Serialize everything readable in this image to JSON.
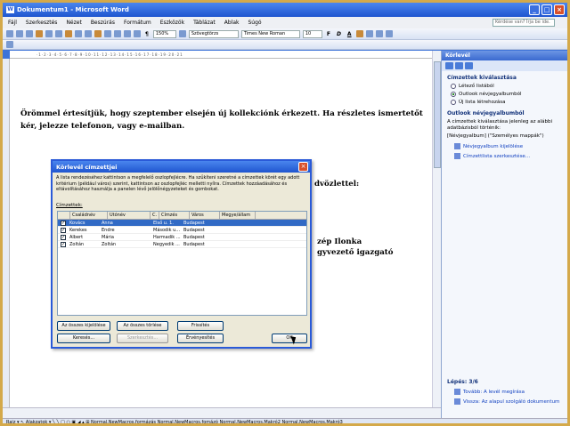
{
  "window": {
    "title": "Dokumentum1 - Microsoft Word",
    "app_icon": "W"
  },
  "menu": {
    "items": [
      "Fájl",
      "Szerkesztés",
      "Nézet",
      "Beszúrás",
      "Formátum",
      "Eszközök",
      "Táblázat",
      "Ablak",
      "Súgó"
    ],
    "help_placeholder": "Kérdése van? Írja be ide."
  },
  "toolbar": {
    "zoom": "150%",
    "style": "Szövegtörzs",
    "font": "Times New Roman",
    "size": "10",
    "bold": "F",
    "italic": "D",
    "underline": "A"
  },
  "document": {
    "paragraph": "Örömmel értesítjük, hogy szeptember elsején új kollekciónk érkezett. Ha részletes ismertetőt kér, jelezze telefonon, vagy e-mailban.",
    "greeting_fragment": "dvözlettel:",
    "signature_name_fragment": "zép Ilonka",
    "signature_title_fragment": "gyvezető igazgató"
  },
  "dialog": {
    "title": "Körlevél címzettjei",
    "description": "A lista rendezéséhez kattintson a megfelelő oszlopfejlécre. Ha szűkíteni szeretné a címzettek körét egy adott kritérium (például város) szerint, kattintson az oszlopfejléc melletti nyílra. Címzettek hozzáadásához és eltávolításához használja a panelen lévő jelölőnégyzeteket és gombokat.",
    "list_label": "Címzettek:",
    "columns": [
      "Családnév",
      "Utónév",
      "C.",
      "Címzés",
      "Város",
      "Megye/állam"
    ],
    "rows": [
      {
        "checked": true,
        "last": "Kovács",
        "first": "Anna",
        "address": "Első u. 1.",
        "city": "Budapest",
        "selected": true
      },
      {
        "checked": true,
        "last": "Kerekes",
        "first": "Endre",
        "address": "Második u...",
        "city": "Budapest",
        "selected": false
      },
      {
        "checked": true,
        "last": "Albert",
        "first": "Mária",
        "address": "Harmadik ...",
        "city": "Budapest",
        "selected": false
      },
      {
        "checked": true,
        "last": "Zoltán",
        "first": "Zoltán",
        "address": "Negyedik ...",
        "city": "Budapest",
        "selected": false
      }
    ],
    "buttons": {
      "select_all": "Az összes kijelölése",
      "clear_all": "Az összes törlése",
      "refresh": "Frissítés",
      "find": "Keresés...",
      "edit": "Szerkesztés...",
      "validate": "Érvényesítés",
      "ok": "OK"
    }
  },
  "taskpane": {
    "title": "Körlevél",
    "section1_title": "Címzettek kiválasztása",
    "options": [
      "Létező listából",
      "Outlook névjegyalbumból",
      "Új lista létrehozása"
    ],
    "selected_option_index": 1,
    "section2_title": "Outlook névjegyalbumból",
    "section2_text": "A címzettek kiválasztása jelenleg az alábbi adatbázisból történik:",
    "source": "[Névjegyalbum] (\"Személyes mappák\")",
    "link1": "Névjegyalbum kijelölése",
    "link2": "Címzettlista szerkesztése...",
    "step": "Lépés: 3/6",
    "next": "Tovább: A levél megírása",
    "prev": "Vissza: Az alapul szolgáló dokumentum"
  },
  "statusbar": {
    "text": "Rajz ▾  ↖  Alakzatok ▾  ╲  ╲  □  ○  ▣  ◢  ▴  ⊞   Normal.NewMacros.formázás  Normal.NewMacros.fomázó   Normal.NewMacros.Makró2  Normal.NewMacros.Makró3"
  },
  "colors": {
    "title_blue": "#1f55cf",
    "selection": "#316ac5",
    "dialog_bg": "#ece9d8",
    "page_bg": "#ffffff"
  }
}
